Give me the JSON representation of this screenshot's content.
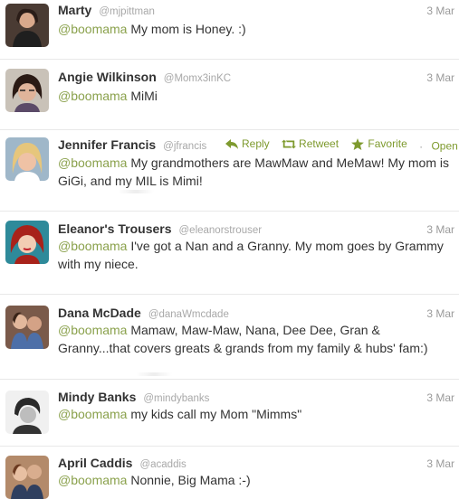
{
  "tweets": [
    {
      "name": "Marty",
      "handle": "@mjpittman",
      "time": "3 Mar",
      "mention": "@boomama",
      "text": " My mom is Honey. :)"
    },
    {
      "name": "Angie Wilkinson",
      "handle": "@Momx3inKC",
      "time": "3 Mar",
      "mention": "@boomama",
      "text": " MiMi"
    },
    {
      "name": "Jennifer Francis",
      "handle": "@jfrancis",
      "time": "",
      "mention": "@boomama",
      "text": " My grandmothers are MawMaw and MeMaw! My mom is GiGi, and my MIL is Mimi!"
    },
    {
      "name": "Eleanor's Trousers",
      "handle": "@eleanorstrouser",
      "time": "3 Mar",
      "mention": "@boomama",
      "text": " I've got a Nan and a Granny. My mom goes by Grammy with my niece."
    },
    {
      "name": "Dana McDade",
      "handle": "@danaWmcdade",
      "time": "3 Mar",
      "mention": "@boomama",
      "text": " Mamaw, Maw-Maw, Nana, Dee Dee, Gran & Granny...that covers greats & grands from my family & hubs' fam:)"
    },
    {
      "name": "Mindy Banks",
      "handle": "@mindybanks",
      "time": "3 Mar",
      "mention": "@boomama",
      "text": " my kids call my Mom \"Mimms\""
    },
    {
      "name": "April Caddis",
      "handle": "@acaddis",
      "time": "3 Mar",
      "mention": "@boomama",
      "text": " Nonnie, Big Mama :-)"
    }
  ],
  "actions": {
    "reply": "Reply",
    "retweet": "Retweet",
    "favorite": "Favorite",
    "separator": "·",
    "open": "Open"
  },
  "colors": {
    "mention": "#8aa14c",
    "action": "#7e9a2e",
    "meta": "#a8a8a8"
  }
}
